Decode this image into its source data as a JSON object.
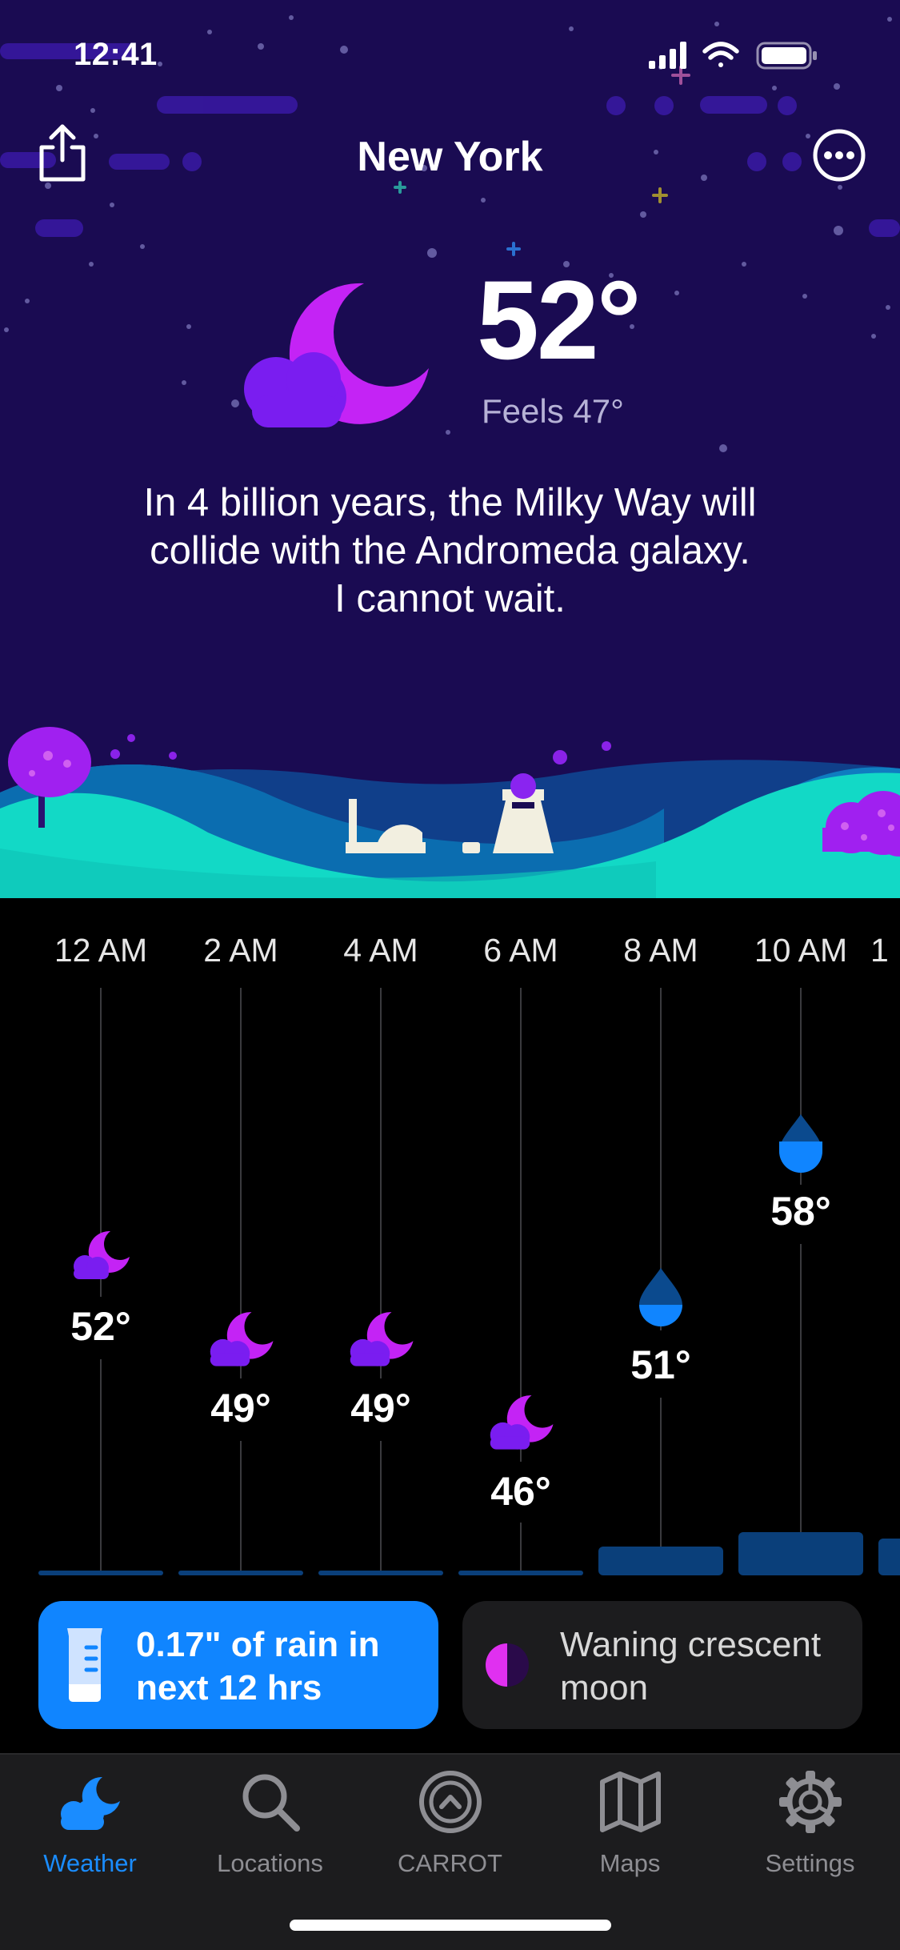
{
  "status_bar": {
    "time": "12:41"
  },
  "header": {
    "city": "New York"
  },
  "current": {
    "temperature": "52°",
    "feels_like": "Feels 47°",
    "icon": "moon-cloud-icon",
    "quip": [
      "In 4 billion years, the Milky Way will",
      "collide with the Andromeda galaxy.",
      "I cannot wait."
    ]
  },
  "hourly": [
    {
      "time": "12 AM",
      "temp": "52°",
      "icon": "moon-cloud-icon"
    },
    {
      "time": "2 AM",
      "temp": "49°",
      "icon": "moon-cloud-icon"
    },
    {
      "time": "4 AM",
      "temp": "49°",
      "icon": "moon-cloud-icon"
    },
    {
      "time": "6 AM",
      "temp": "46°",
      "icon": "moon-cloud-icon"
    },
    {
      "time": "8 AM",
      "temp": "51°",
      "icon": "raindrop-icon"
    },
    {
      "time": "10 AM",
      "temp": "58°",
      "icon": "raindrop-icon"
    },
    {
      "time": "1",
      "temp": "",
      "icon": ""
    }
  ],
  "cards": {
    "rain": {
      "line1": "0.17\" of rain in",
      "line2": "next 12 hrs",
      "icon": "rain-gauge-icon"
    },
    "moon": {
      "line1": "Waning crescent",
      "line2": "moon",
      "icon": "moon-phase-icon"
    }
  },
  "tabs": [
    {
      "label": "Weather",
      "icon": "weather-icon",
      "active": true
    },
    {
      "label": "Locations",
      "icon": "search-icon",
      "active": false
    },
    {
      "label": "CARROT",
      "icon": "carrot-icon",
      "active": false
    },
    {
      "label": "Maps",
      "icon": "map-icon",
      "active": false
    },
    {
      "label": "Settings",
      "icon": "gear-icon",
      "active": false
    }
  ],
  "colors": {
    "sky": "#1a0b52",
    "accent_purple": "#b020f0",
    "cloud_purple": "#7c1ff0",
    "rain_blue": "#1085ff",
    "tab_active": "#1a8cff",
    "ground_teal": "#10e0c8"
  }
}
